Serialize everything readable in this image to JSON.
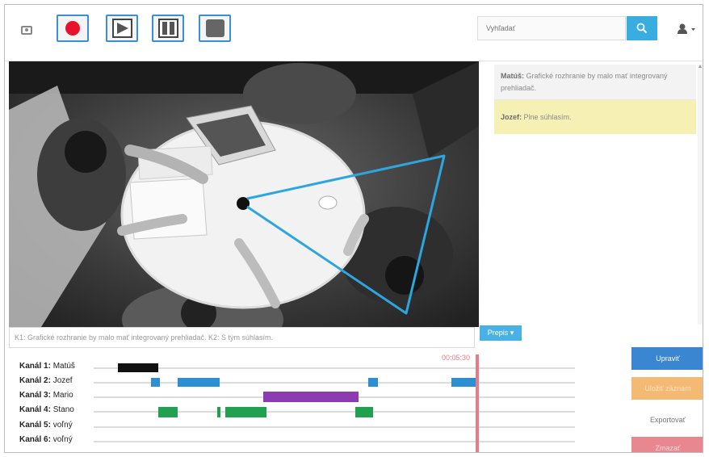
{
  "toolbar": {
    "camera_icon": "camera-icon",
    "record_icon": "record-icon",
    "play_icon": "play-icon",
    "pause_icon": "pause-icon",
    "stop_icon": "stop-icon",
    "search_placeholder": "Vyhľadať",
    "search_icon": "search-icon",
    "user_icon": "user-icon"
  },
  "chat": {
    "messages": [
      {
        "author": "Matúš:",
        "text": "Grafické rozhranie by malo mať integrovaný prehliadač."
      },
      {
        "author": "Jozef:",
        "text": "Plne súhlasím."
      }
    ]
  },
  "transcript": {
    "text": "K1: Grafické rozhranie by malo mať integrovaný prehliadač. K2: S tým súhlasím."
  },
  "export_button": "Prepis ▾",
  "timeline": {
    "current_time": "00:05:30",
    "channels": [
      {
        "label": "Kanál 1:",
        "name": "Matúš",
        "color": "#111111"
      },
      {
        "label": "Kanál 2:",
        "name": "Jozef",
        "color": "#2c8fd4"
      },
      {
        "label": "Kanál 3:",
        "name": "Mario",
        "color": "#8c3bb0"
      },
      {
        "label": "Kanál 4:",
        "name": "Stano",
        "color": "#21a150"
      },
      {
        "label": "Kanál 5:",
        "name": "voľný",
        "color": "#dcdcdc"
      },
      {
        "label": "Kanál 6:",
        "name": "voľný",
        "color": "#dcdcdc"
      }
    ]
  },
  "actions": {
    "edit": "Upraviť",
    "save": "Uložiť záznam",
    "export": "Exportovať",
    "delete": "Zmazať"
  },
  "colors": {
    "accent": "#38aee0",
    "record": "#e8132a",
    "edit": "#3a86d1",
    "save": "#f4b972",
    "delete": "#e98790",
    "highlight": "#f7f0b4"
  }
}
